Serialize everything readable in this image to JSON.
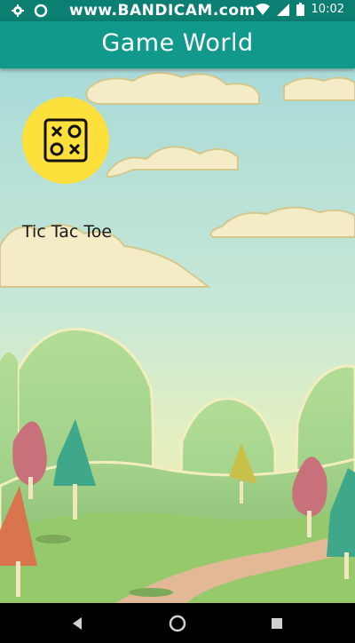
{
  "status_bar": {
    "watermark": "www.BANDICAM.com",
    "time": "10:02"
  },
  "app_bar": {
    "title": "Game World"
  },
  "games": [
    {
      "label": "Tic Tac Toe",
      "icon": "tic-tac-toe-icon"
    }
  ],
  "nav_bar": {
    "buttons": [
      "back-icon",
      "home-icon",
      "recents-icon"
    ]
  },
  "colors": {
    "status_bar": "#0b7f72",
    "app_bar": "#119a8b",
    "icon_circle": "#fde03c"
  }
}
